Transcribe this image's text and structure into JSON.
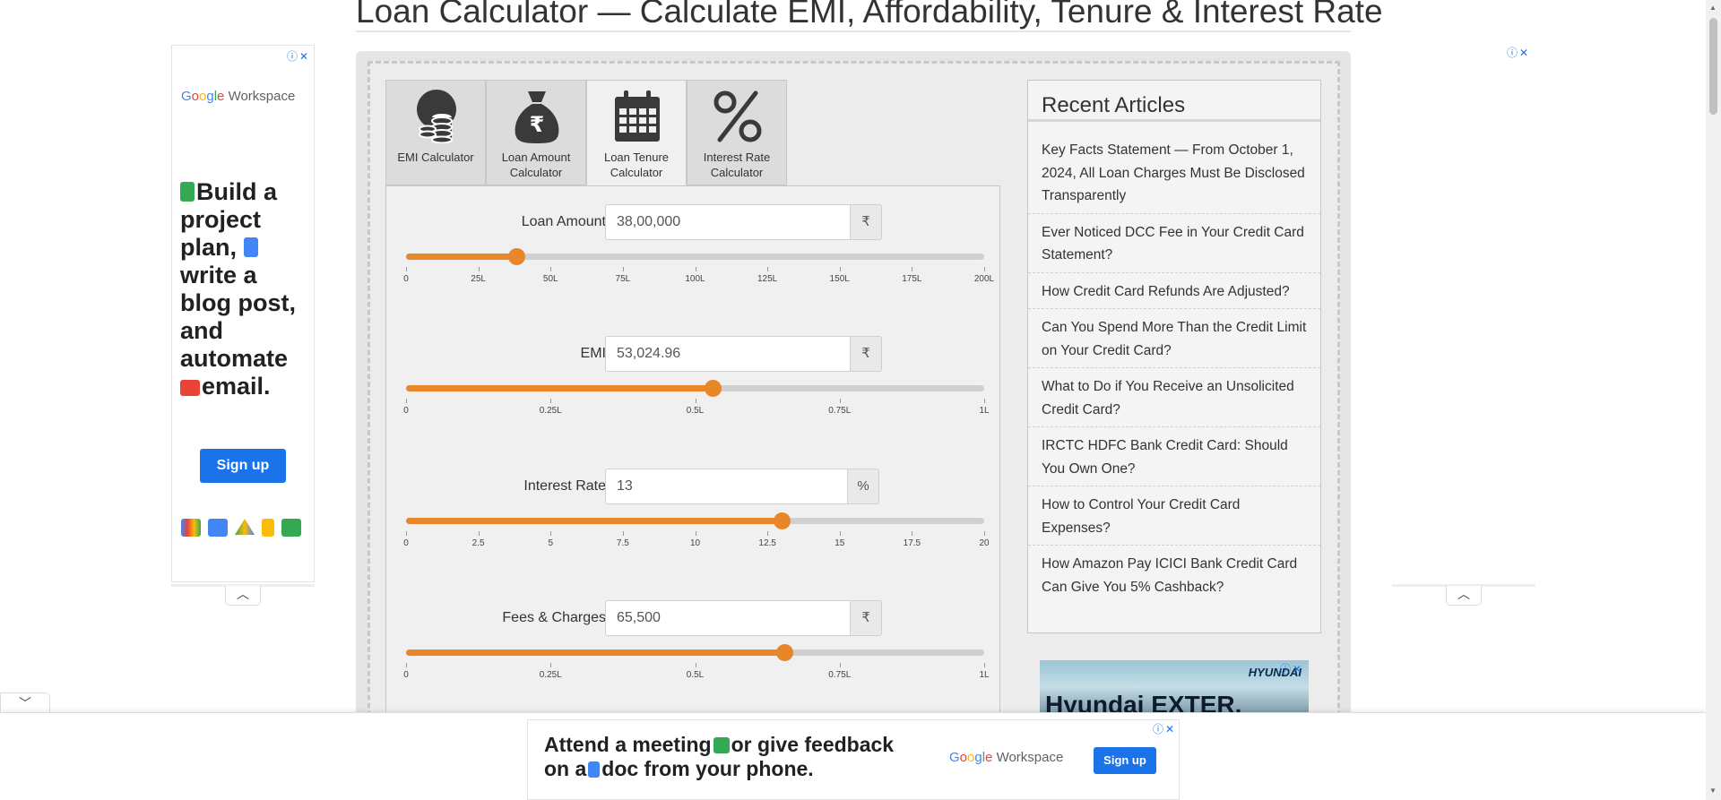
{
  "page": {
    "title": "Loan Calculator — Calculate EMI, Affordability, Tenure & Interest Rate"
  },
  "tabs": [
    {
      "label": "EMI Calculator",
      "icon": "coins-icon",
      "active": false
    },
    {
      "label": "Loan Amount Calculator",
      "icon": "money-bag-icon",
      "active": false
    },
    {
      "label": "Loan Tenure Calculator",
      "icon": "calendar-icon",
      "active": true
    },
    {
      "label": "Interest Rate Calculator",
      "icon": "percent-icon",
      "active": false
    }
  ],
  "fields": {
    "loan_amount": {
      "label": "Loan Amount",
      "value": "38,00,000",
      "unit": "₹",
      "slider_fraction": 0.19,
      "ticks": [
        "0",
        "25L",
        "50L",
        "75L",
        "100L",
        "125L",
        "150L",
        "175L",
        "200L"
      ]
    },
    "emi": {
      "label": "EMI",
      "value": "53,024.96",
      "unit": "₹",
      "slider_fraction": 0.53,
      "ticks": [
        "0",
        "0.25L",
        "0.5L",
        "0.75L",
        "1L"
      ]
    },
    "interest_rate": {
      "label": "Interest Rate",
      "value": "13",
      "unit": "%",
      "slider_fraction": 0.65,
      "ticks": [
        "0",
        "2.5",
        "5",
        "7.5",
        "10",
        "12.5",
        "15",
        "17.5",
        "20"
      ]
    },
    "fees_charges": {
      "label": "Fees & Charges",
      "value": "65,500",
      "unit": "₹",
      "slider_fraction": 0.655,
      "ticks": [
        "0",
        "0.25L",
        "0.5L",
        "0.75L",
        "1L"
      ]
    }
  },
  "recent_articles": {
    "title": "Recent Articles",
    "items": [
      "Key Facts Statement — From October 1, 2024, All Loan Charges Must Be Disclosed Transparently",
      "Ever Noticed DCC Fee in Your Credit Card Statement?",
      "How Credit Card Refunds Are Adjusted?",
      "Can You Spend More Than the Credit Limit on Your Credit Card?",
      "What to Do if You Receive an Unsolicited Credit Card?",
      "IRCTC HDFC Bank Credit Card: Should You Own One?",
      "How to Control Your Credit Card Expenses?",
      "How Amazon Pay ICICI Bank Credit Card Can Give You 5% Cashback?"
    ]
  },
  "ads": {
    "left": {
      "brand": "Google Workspace",
      "headline_parts": [
        "Build a project plan,",
        "write a blog post, and automate",
        "email."
      ],
      "cta": "Sign up"
    },
    "bottom": {
      "line1": "Attend a meeting",
      "line1b": "or give feedback",
      "line2": "on a",
      "line2b": "doc from your phone.",
      "brand": "Google Workspace",
      "cta": "Sign up"
    },
    "hyundai": {
      "brand": "HYUNDAI",
      "title": "Hyundai EXTER."
    },
    "close_glyph": "ⓘ✕"
  },
  "colors": {
    "accent": "#e8862a",
    "google_blue": "#1a73e8"
  }
}
